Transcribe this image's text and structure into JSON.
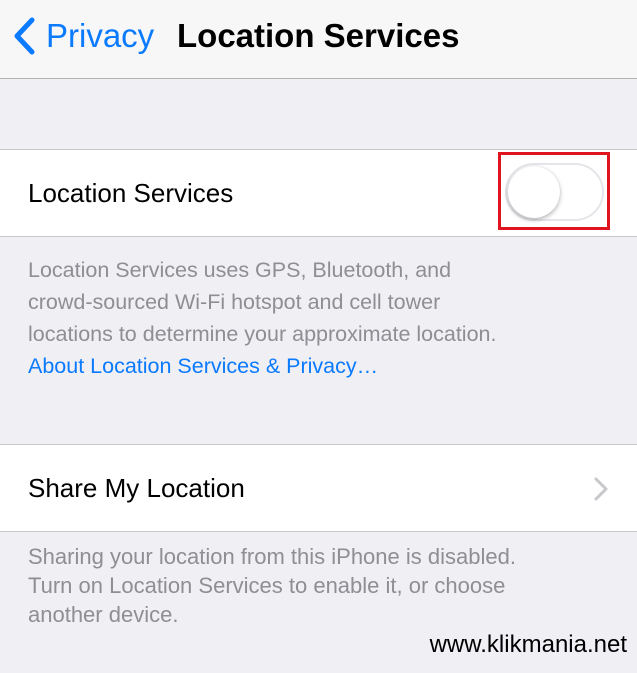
{
  "nav": {
    "back_label": "Privacy",
    "title": "Location Services"
  },
  "location_services": {
    "label": "Location Services",
    "toggle_on": false,
    "footer_lines": [
      "Location Services uses GPS, Bluetooth, and",
      "crowd-sourced Wi-Fi hotspot and cell tower",
      "locations to determine your approximate location."
    ],
    "about_link": "About Location Services & Privacy…"
  },
  "share_my_location": {
    "label": "Share My Location",
    "footer_lines": [
      "Sharing your location from this iPhone is disabled.",
      "Turn on Location Services to enable it, or choose",
      "another device."
    ]
  },
  "watermark": "www.klikmania.net",
  "colors": {
    "accent": "#0a7aff",
    "highlight": "#e0141e",
    "background": "#efeff4",
    "secondary_text": "#8e8e93"
  },
  "icons": {
    "back": "chevron-left-icon",
    "disclosure": "chevron-right-icon"
  }
}
